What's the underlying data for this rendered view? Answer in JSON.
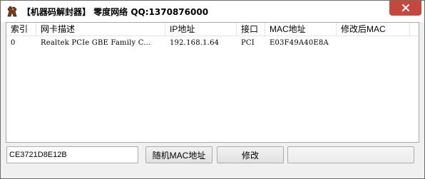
{
  "window": {
    "title": "【机器码解封器】 零度网络 QQ:1370876000"
  },
  "listview": {
    "columns": [
      "索引",
      "网卡描述",
      "IP地址",
      "接口",
      "MAC地址",
      "修改后MAC"
    ],
    "rows": [
      [
        "0",
        "Realtek PCIe GBE Family C...",
        "192.168.1.64",
        "PCI",
        "E03F49A40E8A",
        ""
      ]
    ]
  },
  "controls": {
    "mac_input_value": "CE3721D8E12B",
    "random_mac_label": "随机MAC地址",
    "modify_label": "修改",
    "third_button_label": ""
  },
  "colors": {
    "close_button": "#c7463e",
    "window_bg": "#f0f0f0"
  },
  "icons": {
    "app": "horse-icon",
    "close": "close-icon"
  }
}
